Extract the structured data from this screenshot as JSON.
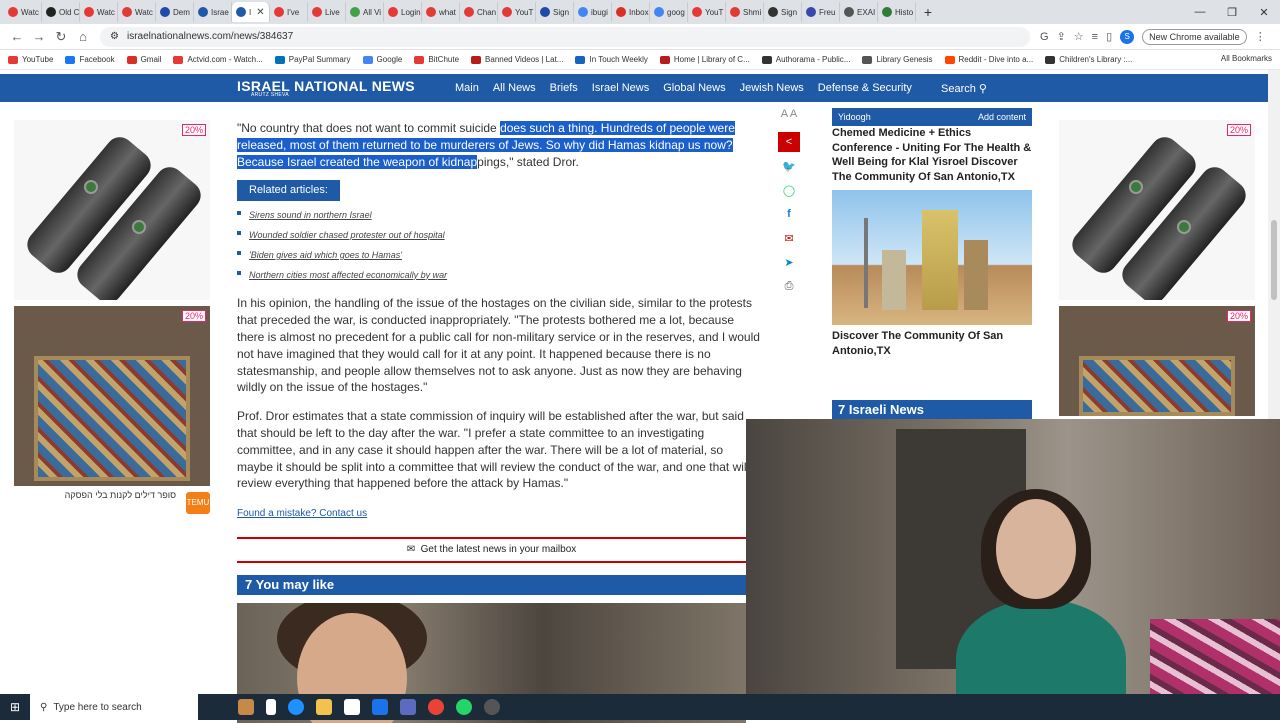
{
  "browser": {
    "tabs": [
      {
        "label": "Watc",
        "color": "#e53935"
      },
      {
        "label": "Old C",
        "color": "#222"
      },
      {
        "label": "Watc",
        "color": "#e53935"
      },
      {
        "label": "Watc",
        "color": "#e53935"
      },
      {
        "label": "Dem",
        "color": "#1e4aa8"
      },
      {
        "label": "Israe",
        "color": "#1f5aa6"
      },
      {
        "label": "I",
        "color": "#1f5aa6",
        "active": true
      },
      {
        "label": "I've",
        "color": "#e53935"
      },
      {
        "label": "Live",
        "color": "#e53935"
      },
      {
        "label": "All Vi",
        "color": "#43a047"
      },
      {
        "label": "Login",
        "color": "#e53935"
      },
      {
        "label": "what",
        "color": "#e53935"
      },
      {
        "label": "Chan",
        "color": "#e53935"
      },
      {
        "label": "YouT",
        "color": "#e53935"
      },
      {
        "label": "Sign",
        "color": "#1e4aa8"
      },
      {
        "label": "ibugi",
        "color": "#4285f4"
      },
      {
        "label": "Inbox",
        "color": "#d93025"
      },
      {
        "label": "goog",
        "color": "#4285f4"
      },
      {
        "label": "YouT",
        "color": "#e53935"
      },
      {
        "label": "Shmi",
        "color": "#e53935"
      },
      {
        "label": "Sign",
        "color": "#333"
      },
      {
        "label": "Freu",
        "color": "#3949ab"
      },
      {
        "label": "EXAI",
        "color": "#555"
      },
      {
        "label": "Histo",
        "color": "#2e7d32"
      }
    ],
    "url": "israelnationalnews.com/news/384637",
    "new_chrome": "New Chrome available",
    "profile_letter": "S",
    "bookmarks": [
      {
        "label": "YouTube",
        "color": "#e53935"
      },
      {
        "label": "Facebook",
        "color": "#1877f2"
      },
      {
        "label": "Gmail",
        "color": "#d93025"
      },
      {
        "label": "Actvid.com - Watch...",
        "color": "#e53935"
      },
      {
        "label": "PayPal Summary",
        "color": "#0070ba"
      },
      {
        "label": "Google",
        "color": "#4285f4"
      },
      {
        "label": "BitChute",
        "color": "#e53935"
      },
      {
        "label": "Banned Videos | Lat...",
        "color": "#b71c1c"
      },
      {
        "label": "In Touch Weekly",
        "color": "#1565c0"
      },
      {
        "label": "Home | Library of C...",
        "color": "#b71c1c"
      },
      {
        "label": "Authorama - Public...",
        "color": "#333"
      },
      {
        "label": "Library Genesis",
        "color": "#555"
      },
      {
        "label": "Reddit - Dive into a...",
        "color": "#ff4500"
      },
      {
        "label": "Children's Library :...",
        "color": "#333"
      }
    ],
    "all_bookmarks": "All Bookmarks"
  },
  "site": {
    "logo": "ISRAEL NATIONAL NEWS",
    "logo_sub": "ARUTZ SHEVA",
    "nav": [
      "Main",
      "All News",
      "Briefs",
      "Israel News",
      "Global News",
      "Jewish News",
      "Defense & Security"
    ],
    "search": "Search"
  },
  "article": {
    "p1_start": "\"No country that does not want to commit suicide ",
    "p1_selected": "does such a thing. Hundreds of people were released, most of them returned to be murderers of Jews. So why did Hamas kidnap us now? Because Israel created the weapon of kidnap",
    "p1_end": "pings,\" stated Dror.",
    "related_title": "Related articles:",
    "related": [
      "Sirens sound in northern Israel",
      "Wounded soldier chased protester out of hospital",
      "'Biden gives aid which goes to Hamas'",
      "Northern cities most affected economically by war"
    ],
    "p2": "In his opinion, the handling of the issue of the hostages on the civilian side, similar to the protests that preceded the war, is conducted inappropriately. \"The protests bothered me a lot, because there is almost no precedent for a public call for non-military service or in the reserves, and I would not have imagined that they would call for it at any point. It happened because there is no statesmanship, and people allow themselves not to ask anyone. Just as now they are behaving wildly on the issue of the hostages.\"",
    "p3": "Prof. Dror estimates that a state commission of inquiry will be established after the war, but said that should be left to the day after the war. \"I prefer a state committee to an investigating committee, and in any case it should happen after the war. There will be a lot of material, so maybe it should be split into a committee that will review the conduct of the war, and one that will review everything that happened before the attack by Hamas.\"",
    "contact": "Found a mistake? Contact us",
    "mailbar": "Get the latest news in your mailbox",
    "you_may_like": "You may like"
  },
  "share": {
    "font_label": "A A"
  },
  "sidebar": {
    "sponsor": "Yidoogh",
    "add_content": "Add content",
    "promo1": "Chemed Medicine + Ethics Conference - Uniting For The Health & Well Being for Klal Yisroel Discover The Community Of San Antonio,TX",
    "promo2": "Discover The Community Of San Antonio,TX",
    "israeli_news": "Israeli News"
  },
  "ads": {
    "percent": "20%",
    "caption": "סופר דילים לקנות בלי הפסקה",
    "brand": "Temu"
  },
  "taskbar": {
    "search_placeholder": "Type here to search"
  }
}
